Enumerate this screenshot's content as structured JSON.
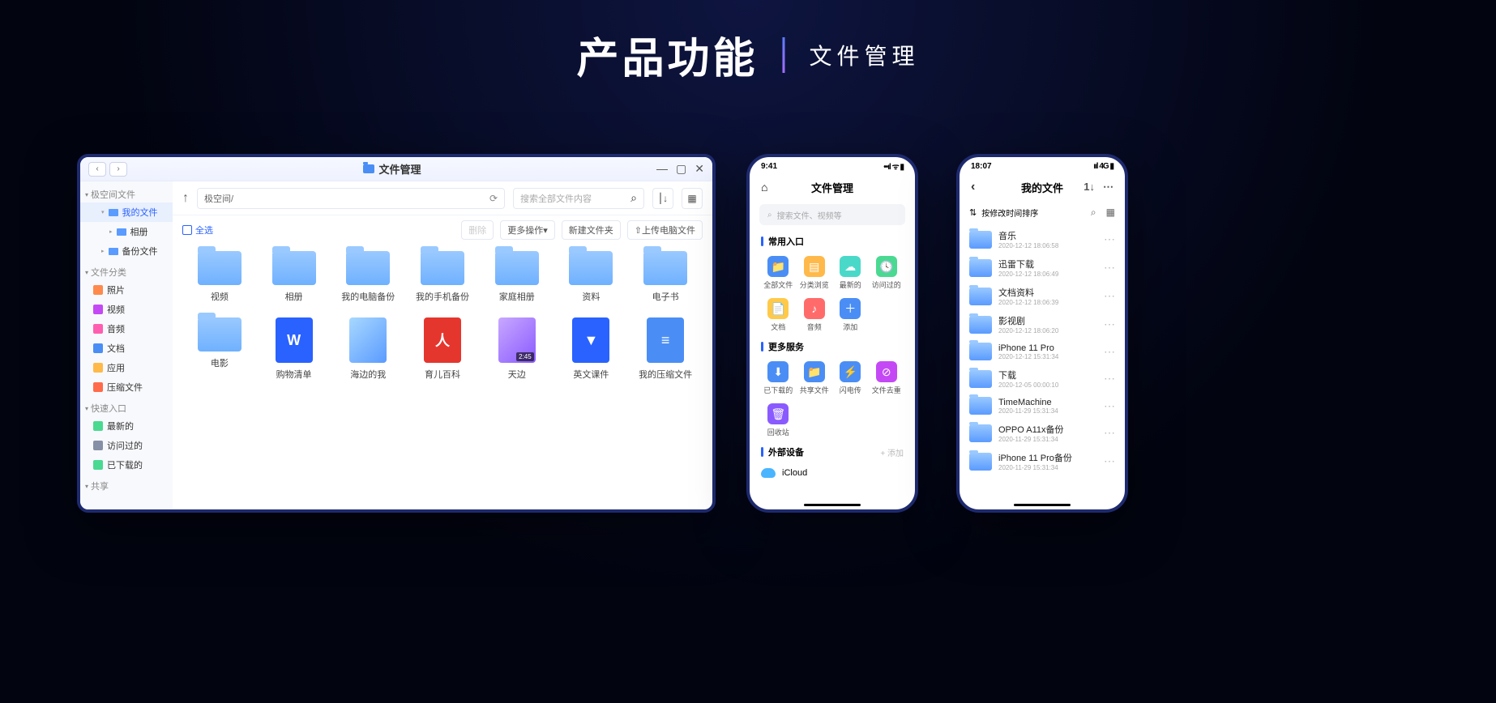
{
  "header": {
    "main": "产品功能",
    "sub": "文件管理"
  },
  "desktop": {
    "title": "文件管理",
    "path": "极空间/",
    "search_placeholder": "搜索全部文件内容",
    "select_all": "全选",
    "actions": {
      "delete": "删除",
      "more": "更多操作",
      "new_folder": "新建文件夹",
      "upload": "上传电脑文件"
    },
    "sidebar": {
      "root": "极空间文件",
      "my_files": "我的文件",
      "album": "相册",
      "backup": "备份文件",
      "category_head": "文件分类",
      "categories": [
        {
          "label": "照片",
          "icon": "ic-photo"
        },
        {
          "label": "视频",
          "icon": "ic-video"
        },
        {
          "label": "音频",
          "icon": "ic-audio"
        },
        {
          "label": "文档",
          "icon": "ic-doc"
        },
        {
          "label": "应用",
          "icon": "ic-app"
        },
        {
          "label": "压缩文件",
          "icon": "ic-zip"
        }
      ],
      "quick_head": "快速入口",
      "quick": [
        {
          "label": "最新的",
          "icon": "ic-new"
        },
        {
          "label": "访问过的",
          "icon": "ic-recent"
        },
        {
          "label": "已下载的",
          "icon": "ic-down"
        }
      ],
      "share_head": "共享"
    },
    "files": [
      {
        "type": "folder",
        "name": "视频"
      },
      {
        "type": "folder",
        "name": "相册"
      },
      {
        "type": "folder",
        "name": "我的电脑备份"
      },
      {
        "type": "folder",
        "name": "我的手机备份"
      },
      {
        "type": "folder",
        "name": "家庭相册"
      },
      {
        "type": "folder",
        "name": "资料"
      },
      {
        "type": "folder",
        "name": "电子书"
      },
      {
        "type": "folder",
        "name": "电影"
      },
      {
        "type": "word",
        "name": "购物清单",
        "glyph": "W"
      },
      {
        "type": "img",
        "name": "海边的我"
      },
      {
        "type": "pdf",
        "name": "育儿百科",
        "glyph": "人"
      },
      {
        "type": "vid",
        "name": "天边",
        "dur": "2:45"
      },
      {
        "type": "ppt",
        "name": "英文课件",
        "glyph": "▼"
      },
      {
        "type": "zip",
        "name": "我的压缩文件",
        "glyph": "≡"
      }
    ]
  },
  "phone1": {
    "time": "9:41",
    "title": "文件管理",
    "search_placeholder": "搜索文件、视频等",
    "sec_common": "常用入口",
    "common": [
      {
        "label": "全部文件",
        "color": "#4a8ef5",
        "glyph": "📁"
      },
      {
        "label": "分类浏览",
        "color": "#ffb94a",
        "glyph": "▤"
      },
      {
        "label": "最新的",
        "color": "#4ad9c9",
        "glyph": "☁"
      },
      {
        "label": "访问过的",
        "color": "#4ad991",
        "glyph": "🕓"
      },
      {
        "label": "文档",
        "color": "#ffc94a",
        "glyph": "📄"
      },
      {
        "label": "音频",
        "color": "#ff6b6b",
        "glyph": "♪"
      },
      {
        "label": "添加",
        "color": "#4a8ef5",
        "glyph": "＋"
      }
    ],
    "sec_more": "更多服务",
    "more": [
      {
        "label": "已下载的",
        "color": "#4a8ef5",
        "glyph": "⬇"
      },
      {
        "label": "共享文件",
        "color": "#4a8ef5",
        "glyph": "📁"
      },
      {
        "label": "闪电传",
        "color": "#4a8ef5",
        "glyph": "⚡"
      },
      {
        "label": "文件去重",
        "color": "#c449f5",
        "glyph": "⊘"
      },
      {
        "label": "回收站",
        "color": "#8a5aff",
        "glyph": "🗑"
      }
    ],
    "sec_ext": "外部设备",
    "ext_add": "+ 添加",
    "icloud": "iCloud"
  },
  "phone2": {
    "time": "18:07",
    "signal": "4G",
    "title": "我的文件",
    "sort": "按修改时间排序",
    "items": [
      {
        "name": "音乐",
        "date": "2020-12-12 18:06:58"
      },
      {
        "name": "迅雷下载",
        "date": "2020-12-12 18:06:49"
      },
      {
        "name": "文档资料",
        "date": "2020-12-12 18:06:39"
      },
      {
        "name": "影视剧",
        "date": "2020-12-12 18:06:20"
      },
      {
        "name": "iPhone 11 Pro",
        "date": "2020-12-12 15:31:34"
      },
      {
        "name": "下载",
        "date": "2020-12-05 00:00:10"
      },
      {
        "name": "TimeMachine",
        "date": "2020-11-29 15:31:34"
      },
      {
        "name": "OPPO A11x备份",
        "date": "2020-11-29 15:31:34"
      },
      {
        "name": "iPhone 11 Pro备份",
        "date": "2020-11-29 15:31:34"
      }
    ]
  }
}
